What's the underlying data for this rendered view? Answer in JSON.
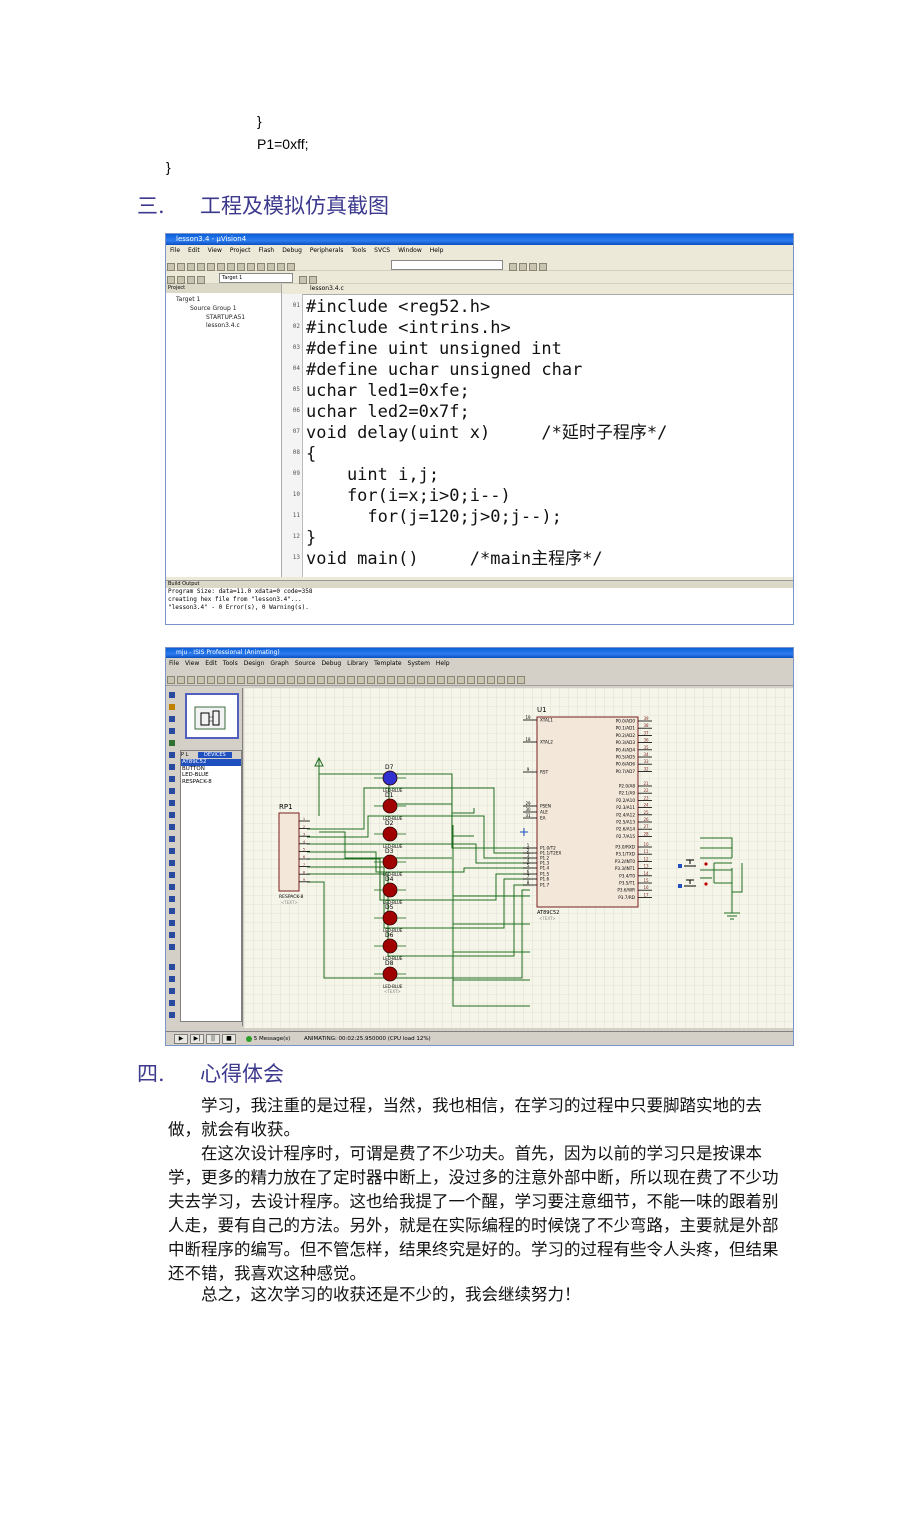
{
  "code_tail": {
    "line1": "}",
    "line2": "P1=0xff;",
    "line3": "}"
  },
  "section3": {
    "number": "三.",
    "title": "工程及模拟仿真截图"
  },
  "uvision": {
    "title": "lesson3.4  - µVision4",
    "menu": [
      "File",
      "Edit",
      "View",
      "Project",
      "Flash",
      "Debug",
      "Peripherals",
      "Tools",
      "SVCS",
      "Window",
      "Help"
    ],
    "target_select": "Target 1",
    "project_header": "Project",
    "tree": [
      "Target 1",
      "Source Group 1",
      "STARTUP.A51",
      "lesson3.4.c"
    ],
    "editor_tab": "lesson3.4.c",
    "line_numbers": [
      "01",
      "02",
      "03",
      "04",
      "05",
      "06",
      "07",
      "08",
      "09",
      "10",
      "11",
      "12",
      "13"
    ],
    "code": [
      "#include <reg52.h>",
      "#include <intrins.h>",
      "#define uint unsigned int",
      "#define uchar unsigned char",
      "uchar led1=0xfe;",
      "uchar led2=0x7f;",
      "void delay(uint x)     /*延时子程序*/",
      "{",
      "    uint i,j;",
      "    for(i=x;i>0;i--)",
      "      for(j=120;j>0;j--);",
      "}",
      "void main()     /*main主程序*/"
    ],
    "build_header": "Build Output",
    "build_output": [
      "Program Size: data=11.0 xdata=0 code=358",
      "creating hex file from \"lesson3.4\"...",
      "\"lesson3.4\" - 0 Error(s), 0 Warning(s)."
    ]
  },
  "isis": {
    "title": "mju - ISIS Professional (Animating)",
    "menu": [
      "File",
      "View",
      "Edit",
      "Tools",
      "Design",
      "Graph",
      "Source",
      "Debug",
      "Library",
      "Template",
      "System",
      "Help"
    ],
    "devices_tabs": [
      "P",
      "L",
      "DEVICES"
    ],
    "devices": [
      "AT89C52",
      "BUTTON",
      "LED-BLUE",
      "RESPACK-8"
    ],
    "schematic": {
      "mcu_ref": "U1",
      "mcu_part": "AT89C52",
      "mcu_text": "<TEXT>",
      "mcu_left_pins": [
        {
          "n": "19",
          "name": "XTAL1"
        },
        {
          "n": "18",
          "name": "XTAL2"
        },
        {
          "n": "9",
          "name": "RST"
        },
        {
          "n": "29",
          "name": "PSEN"
        },
        {
          "n": "30",
          "name": "ALE"
        },
        {
          "n": "31",
          "name": "EA"
        },
        {
          "n": "1",
          "name": "P1.0/T2"
        },
        {
          "n": "2",
          "name": "P1.1/T2EX"
        },
        {
          "n": "3",
          "name": "P1.2"
        },
        {
          "n": "4",
          "name": "P1.3"
        },
        {
          "n": "5",
          "name": "P1.4"
        },
        {
          "n": "6",
          "name": "P1.5"
        },
        {
          "n": "7",
          "name": "P1.6"
        },
        {
          "n": "8",
          "name": "P1.7"
        }
      ],
      "mcu_right_pins": [
        {
          "n": "39",
          "name": "P0.0/AD0"
        },
        {
          "n": "38",
          "name": "P0.1/AD1"
        },
        {
          "n": "37",
          "name": "P0.2/AD2"
        },
        {
          "n": "36",
          "name": "P0.3/AD3"
        },
        {
          "n": "35",
          "name": "P0.4/AD4"
        },
        {
          "n": "34",
          "name": "P0.5/AD5"
        },
        {
          "n": "33",
          "name": "P0.6/AD6"
        },
        {
          "n": "32",
          "name": "P0.7/AD7"
        },
        {
          "n": "21",
          "name": "P2.0/A8"
        },
        {
          "n": "22",
          "name": "P2.1/A9"
        },
        {
          "n": "23",
          "name": "P2.2/A10"
        },
        {
          "n": "24",
          "name": "P2.3/A11"
        },
        {
          "n": "25",
          "name": "P2.4/A12"
        },
        {
          "n": "26",
          "name": "P2.5/A13"
        },
        {
          "n": "27",
          "name": "P2.6/A14"
        },
        {
          "n": "28",
          "name": "P2.7/A15"
        },
        {
          "n": "10",
          "name": "P3.0/RXD"
        },
        {
          "n": "11",
          "name": "P3.1/TXD"
        },
        {
          "n": "12",
          "name": "P3.2/INT0"
        },
        {
          "n": "13",
          "name": "P3.3/INT1"
        },
        {
          "n": "14",
          "name": "P3.4/T0"
        },
        {
          "n": "15",
          "name": "P3.5/T1"
        },
        {
          "n": "16",
          "name": "P3.6/WR"
        },
        {
          "n": "17",
          "name": "P3.7/RD"
        }
      ],
      "rp_ref": "RP1",
      "rp_part": "RESPACK-8",
      "rp_text": "<TEXT>",
      "leds": [
        "D7",
        "D1",
        "D2",
        "D3",
        "D4",
        "D5",
        "D6",
        "D8"
      ],
      "led_part": "LED-BLUE",
      "led_text": "<TEXT>"
    },
    "status_messages": "5 Message(s)",
    "status_text": "ANIMATING: 00:02:25.950000 (CPU load 12%)"
  },
  "section4": {
    "number": "四.",
    "title": "心得体会",
    "paragraphs": [
      "学习，我注重的是过程，当然，我也相信，在学习的过程中只要脚踏实地的去做，就会有收获。",
      "在这次设计程序时，可谓是费了不少功夫。首先，因为以前的学习只是按课本学，更多的精力放在了定时器中断上，没过多的注意外部中断，所以现在费了不少功夫去学习，去设计程序。这也给我提了一个醒，学习要注意细节，不能一味的跟着别人走，要有自己的方法。另外，就是在实际编程的时候饶了不少弯路，主要就是外部中断程序的编写。但不管怎样，结果终究是好的。学习的过程有些令人头疼，但结果还不错，我喜欢这种感觉。",
      "总之，这次学习的收获还是不少的，我会继续努力！"
    ]
  }
}
